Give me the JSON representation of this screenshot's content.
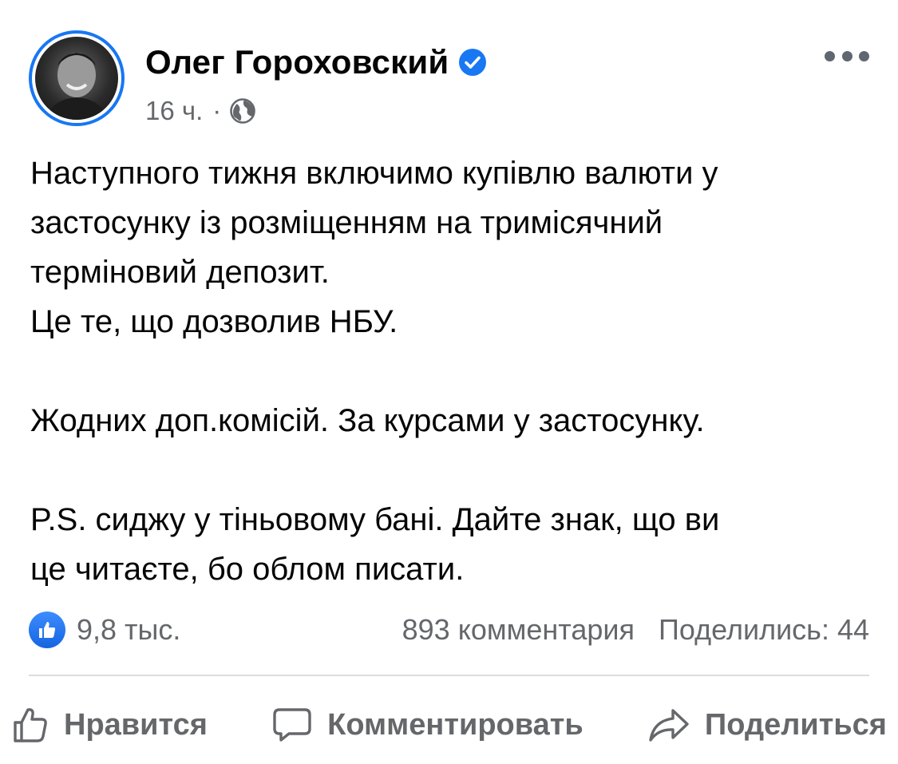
{
  "header": {
    "author_name": "Олег Гороховский",
    "timestamp": "16 ч.",
    "separator": "·",
    "privacy_icon": "globe-icon",
    "verified_icon": "verified-badge-icon",
    "more_icon": "more-horizontal-icon"
  },
  "post": {
    "paragraphs": [
      "Наступного тижня включимо купівлю валюти у",
      "застосунку із розміщенням на тримісячний",
      "терміновий депозит.",
      "Це те, що дозволив НБУ.",
      "",
      "Жодних доп.комісій. За курсами у застосунку.",
      "",
      "P.S. сиджу у тіньовому бані. Дайте знак, що ви",
      "це читаєте, бо облом писати."
    ]
  },
  "stats": {
    "reactions": "9,8 тыс.",
    "comments": "893 комментария",
    "shares": "Поделились: 44"
  },
  "actions": {
    "like_label": "Нравится",
    "comment_label": "Комментировать",
    "share_label": "Поделиться"
  },
  "colors": {
    "accent": "#1877f2",
    "secondary_text": "#65676b",
    "primary_text": "#050505",
    "divider": "#dadde1"
  }
}
